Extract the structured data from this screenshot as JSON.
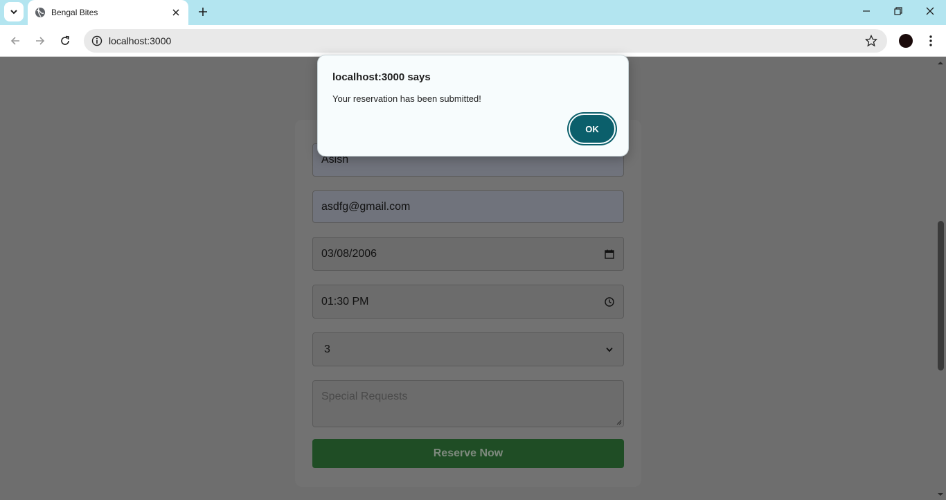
{
  "browser": {
    "tab_title": "Bengal Bites",
    "url": "localhost:3000"
  },
  "form": {
    "name_value": "Asish",
    "email_value": "asdfg@gmail.com",
    "date_value": "03/08/2006",
    "time_value": "01:30 PM",
    "guests_value": "3",
    "special_requests_placeholder": "Special Requests",
    "submit_label": "Reserve Now"
  },
  "dialog": {
    "title": "localhost:3000 says",
    "message": "Your reservation has been submitted!",
    "ok_label": "OK"
  },
  "colors": {
    "tabbar_bg": "#b3e5f0",
    "dialog_ok": "#0b5f6b",
    "reserve_button": "#1f4d25",
    "overlay": "#6e6e6e"
  },
  "icons": {
    "tab_search": "chevron-down-icon",
    "favicon": "globe-icon",
    "tab_close": "close-icon",
    "new_tab": "plus-icon",
    "minimize": "minimize-icon",
    "restore": "restore-icon",
    "close_window": "close-icon",
    "back": "arrow-left-icon",
    "forward": "arrow-right-icon",
    "reload": "reload-icon",
    "site_info": "info-icon",
    "bookmark": "star-icon",
    "menu": "kebab-icon",
    "date": "calendar-icon",
    "time": "clock-icon",
    "select": "chevron-down-icon"
  }
}
